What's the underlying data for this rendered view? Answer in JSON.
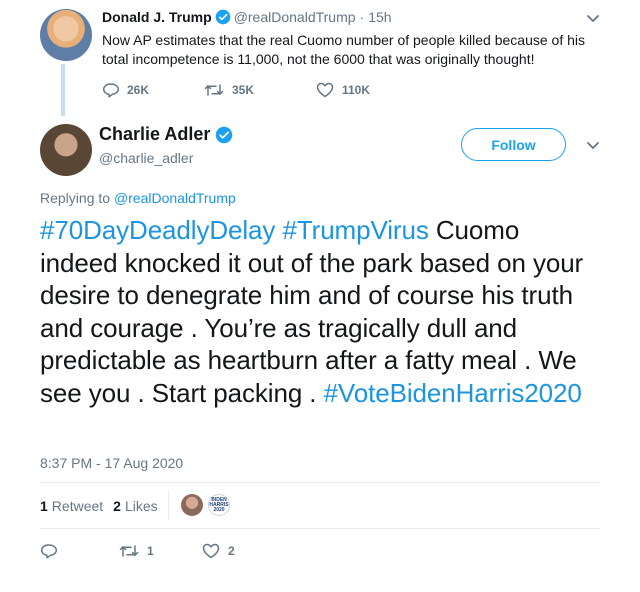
{
  "parent_tweet": {
    "name": "Donald J. Trump",
    "handle": "@realDonaldTrump",
    "separator": "·",
    "time": "15h",
    "text": "Now AP estimates that the real Cuomo number of people killed because of his total incompetence is 11,000, not the 6000 that was originally thought!",
    "reply_count": "26K",
    "retweet_count": "35K",
    "like_count": "110K"
  },
  "main_tweet": {
    "name": "Charlie Adler",
    "handle": "@charlie_adler",
    "follow_label": "Follow",
    "replying_prefix": "Replying to",
    "replying_to": "@realDonaldTrump",
    "hashtag1": "#70DayDeadlyDelay",
    "hashtag2": "#TrumpVirus",
    "body": " Cuomo indeed knocked it out of the park based on your desire to denegrate him and of course his truth and courage  . You’re as tragically dull and predictable as heartburn after a fatty meal .  We see you . Start packing . ",
    "hashtag3": "#VoteBidenHarris2020",
    "timestamp": "8:37 PM - 17 Aug 2020",
    "retweets_num": "1",
    "retweets_label": "Retweet",
    "likes_num": "2",
    "likes_label": "Likes",
    "badge_text": "BIDEN HARRIS 2020",
    "retweet_count": "1",
    "like_count": "2"
  },
  "colors": {
    "accent": "#1da1f2",
    "link": "#1b95e0",
    "muted": "#657786"
  }
}
